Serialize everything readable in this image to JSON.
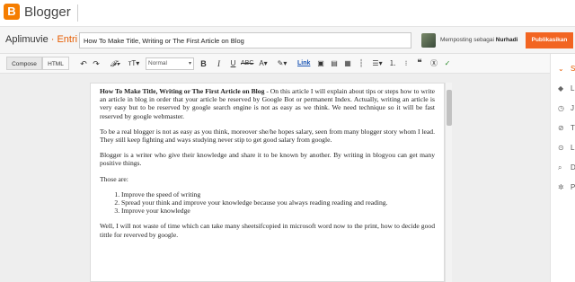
{
  "app": {
    "brand": "Blogger",
    "logo": "B"
  },
  "titlebar": {
    "blog_name": "Aplimuvie",
    "crumb": "· Entri",
    "post_title": "How To Make Title, Writing or The First Article on Blog",
    "posting_as_prefix": "Memposting sebagai",
    "posting_as_user": "Nurhadi",
    "publish_label": "Publikasikan"
  },
  "toolbar": {
    "compose_label": "Compose",
    "html_label": "HTML",
    "format_value": "Normal",
    "link_label": "Link",
    "icons": [
      "undo-icon",
      "redo-icon",
      "font-family-icon",
      "font-size-icon",
      "bold-icon",
      "italic-icon",
      "underline-icon",
      "strikethrough-icon",
      "text-color-icon",
      "highlight-icon",
      "link",
      "image-icon",
      "video-icon",
      "jump-break-icon",
      "align-icon",
      "numbered-list-icon",
      "bulleted-list-icon",
      "quote-icon",
      "clear-format-icon",
      "spellcheck-icon"
    ]
  },
  "document": {
    "p1_lead": "How To Make Title, Writing or The First Article on Blog",
    "p1_rest": " - On this article I will explain about tips or steps how to write an article in blog in order that your article be reserved by Google Bot or permanent Index. Actually,  writing an article is very easy but to be reserved by google search engine is not as easy as we think. We need technique so it will be fast reserved by google webmaster.",
    "p2": "To be a real blogger is not as easy as you think, moreover she/he hopes salary, seen from many blogger story whom I lead. They still keep fighting and ways studying never stip to get good salary from google.",
    "p3": "Blogger is a writer who give their knowledge and share it to be known by another.  By writing in blogyou can get many positive things.",
    "p4": "Those are:",
    "list": [
      "Improve the speed of writing",
      "Spread your think and improve your knowledge because you always reading reading and reading.",
      "Improve your knowledge"
    ],
    "p5": "Well,  I will not waste of time which can take many sheetsifcopied in microsoft word now to the print,  how to decide good tittle for reverved by google."
  },
  "sidebar": {
    "items": [
      {
        "icon": "settings-icon",
        "glyph": "⌄",
        "label": "Se"
      },
      {
        "icon": "label-icon",
        "glyph": "◆",
        "label": "L"
      },
      {
        "icon": "schedule-icon",
        "glyph": "◷",
        "label": "J"
      },
      {
        "icon": "permalink-icon",
        "glyph": "⊘",
        "label": "T"
      },
      {
        "icon": "location-icon",
        "glyph": "⊙",
        "label": "L"
      },
      {
        "icon": "search-description-icon",
        "glyph": "⌕",
        "label": "D"
      },
      {
        "icon": "options-icon",
        "glyph": "✲",
        "label": "P"
      }
    ]
  },
  "colors": {
    "accent": "#f26522",
    "brand": "#f57d00"
  }
}
